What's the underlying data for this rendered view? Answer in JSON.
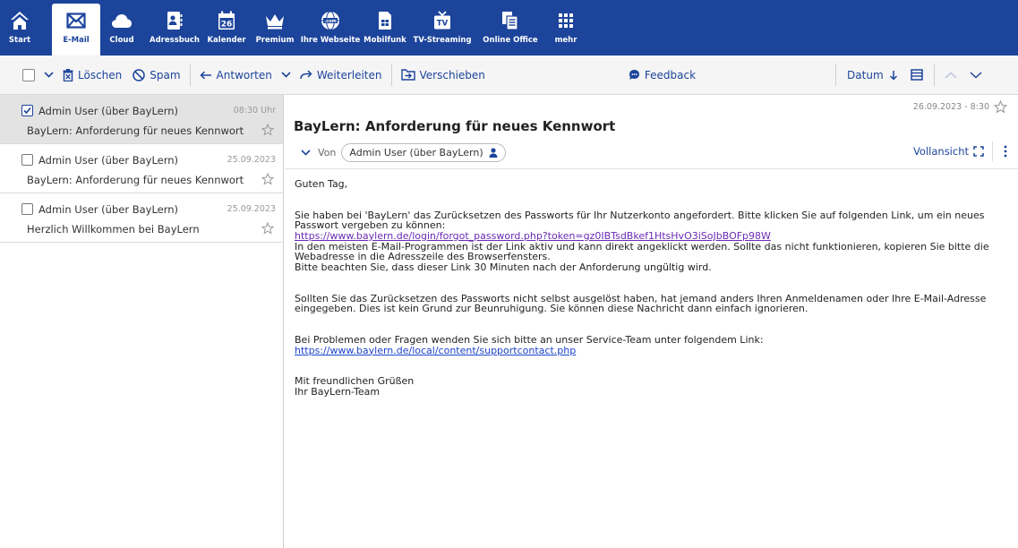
{
  "nav": {
    "items": [
      {
        "label": "Start",
        "icon": "home-icon"
      },
      {
        "label": "E-Mail",
        "icon": "mail-icon"
      },
      {
        "label": "Cloud",
        "icon": "cloud-icon"
      },
      {
        "label": "Adressbuch",
        "icon": "addressbook-icon"
      },
      {
        "label": "Kalender",
        "icon": "calendar-icon",
        "badge": "26"
      },
      {
        "label": "Premium",
        "icon": "crown-icon"
      },
      {
        "label": "Ihre Webseite",
        "icon": "globe-icon"
      },
      {
        "label": "Mobilfunk",
        "icon": "sim-icon"
      },
      {
        "label": "TV-Streaming",
        "icon": "tv-icon"
      },
      {
        "label": "Online Office",
        "icon": "office-icon"
      },
      {
        "label": "mehr",
        "icon": "grid-icon"
      }
    ],
    "active": "E-Mail",
    "colors": {
      "bar": "#1c449b",
      "accent": "#1c449b"
    }
  },
  "toolbar": {
    "delete": "Löschen",
    "spam": "Spam",
    "reply": "Antworten",
    "forward": "Weiterleiten",
    "move": "Verschieben",
    "feedback": "Feedback",
    "sort": "Datum"
  },
  "list": {
    "messages": [
      {
        "from": "Admin User (über BayLern)",
        "date": "08:30 Uhr",
        "subject": "BayLern: Anforderung für neues Kennwort",
        "selected": true,
        "checked": true
      },
      {
        "from": "Admin User (über BayLern)",
        "date": "25.09.2023",
        "subject": "BayLern: Anforderung für neues Kennwort",
        "selected": false,
        "checked": false
      },
      {
        "from": "Admin User (über BayLern)",
        "date": "25.09.2023",
        "subject": "Herzlich Willkommen bei BayLern",
        "selected": false,
        "checked": false
      }
    ]
  },
  "message": {
    "datetime": "26.09.2023 - 8:30",
    "subject": "BayLern: Anforderung für neues Kennwort",
    "from_label": "Von",
    "sender": "Admin User (über BayLern)",
    "fullview": "Vollansicht",
    "body": {
      "greeting": "Guten Tag,",
      "p1": "Sie haben bei 'BayLern' das Zurücksetzen des Passworts für Ihr Nutzerkonto angefordert. Bitte klicken Sie auf folgenden Link, um ein neues Passwort vergeben zu können:",
      "reset_link": "https://www.baylern.de/login/forgot_password.php?token=gz0IBTsdBkef1HtsHvO3iSoJbBOFp98W",
      "p2": "In den meisten E-Mail-Programmen ist der Link aktiv und kann direkt angeklickt werden. Sollte das nicht funktionieren, kopieren Sie bitte die Webadresse in die Adresszeile des Browserfensters.",
      "p3": "Bitte beachten Sie, dass dieser Link 30 Minuten nach der Anforderung ungültig wird.",
      "p4": "Sollten Sie das Zurücksetzen des Passworts nicht selbst ausgelöst haben, hat jemand anders Ihren Anmeldenamen oder Ihre E-Mail-Adresse eingegeben. Dies ist kein Grund zur Beunruhigung. Sie können diese Nachricht dann einfach ignorieren.",
      "p5": "Bei Problemen oder Fragen wenden Sie sich bitte an unser Service-Team unter folgendem Link:",
      "support_link": "https://www.baylern.de/local/content/supportcontact.php",
      "closing": "Mit freundlichen Grüßen",
      "signature": "Ihr BayLern-Team"
    }
  }
}
